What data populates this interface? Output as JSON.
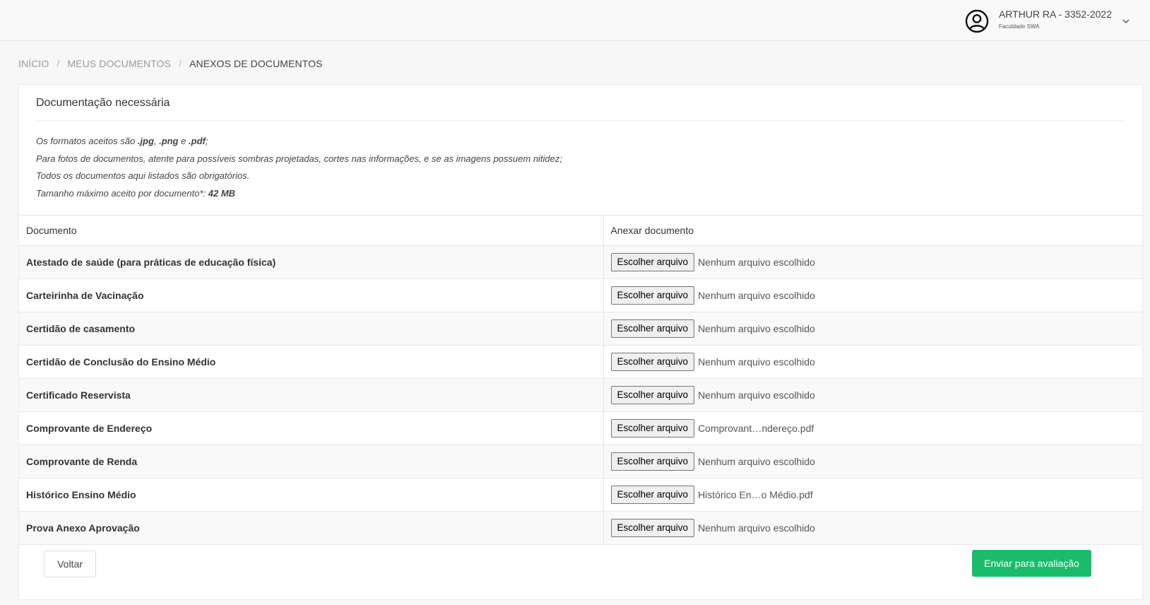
{
  "header": {
    "user_name": "ARTHUR RA - 3352-2022",
    "org": "Faculdade SWA",
    "avatar_icon": "user-circle-icon",
    "menu_icon": "chevron-down-icon"
  },
  "breadcrumb": {
    "items": [
      "INÍCIO",
      "MEUS DOCUMENTOS",
      "ANEXOS DE DOCUMENTOS"
    ],
    "separator": "/"
  },
  "card": {
    "title": "Documentação necessária",
    "notes": {
      "line1_pre": "Os formatos aceitos são ",
      "line1_jpg": ".jpg",
      "line1_sep1": ", ",
      "line1_png": ".png",
      "line1_sep2": " e ",
      "line1_pdf": ".pdf",
      "line1_post": ";",
      "line2": "Para fotos de documentos, atente para possíveis sombras projetadas, cortes nas informações, e se as imagens possuem nitidez;",
      "line3": "Todos os documentos aqui listados são obrigatórios.",
      "line4_pre": "Tamanho máximo aceito por documento*: ",
      "line4_size": "42 MB"
    }
  },
  "table": {
    "headers": [
      "Documento",
      "Anexar documento"
    ],
    "button_label": "Escolher arquivo",
    "rows": [
      {
        "document": "Atestado de saúde (para práticas de educação física)",
        "file": "Nenhum arquivo escolhido"
      },
      {
        "document": "Carteirinha de Vacinação",
        "file": "Nenhum arquivo escolhido"
      },
      {
        "document": "Certidão de casamento",
        "file": "Nenhum arquivo escolhido"
      },
      {
        "document": "Certidão de Conclusão do Ensino Médio",
        "file": "Nenhum arquivo escolhido"
      },
      {
        "document": "Certificado Reservista",
        "file": "Nenhum arquivo escolhido"
      },
      {
        "document": "Comprovante de Endereço",
        "file": "Comprovant…ndereço.pdf"
      },
      {
        "document": "Comprovante de Renda",
        "file": "Nenhum arquivo escolhido"
      },
      {
        "document": "Histórico Ensino Médio",
        "file": "Histórico En…o Médio.pdf"
      },
      {
        "document": "Prova Anexo Aprovação",
        "file": "Nenhum arquivo escolhido"
      }
    ]
  },
  "actions": {
    "back_label": "Voltar",
    "submit_label": "Enviar para avaliação"
  },
  "colors": {
    "submit": "#1abc6c"
  }
}
